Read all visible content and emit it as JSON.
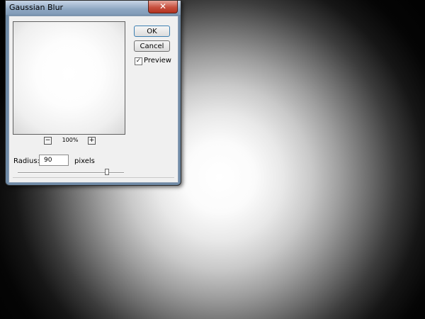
{
  "dialog": {
    "title": "Gaussian Blur",
    "close_glyph": "✕",
    "ok_label": "OK",
    "cancel_label": "Cancel",
    "preview": {
      "checked": true,
      "check_glyph": "✓",
      "label": "Preview"
    },
    "zoom": {
      "out_glyph": "−",
      "in_glyph": "+",
      "level": "100%"
    },
    "radius": {
      "label": "Radius:",
      "value": "90",
      "unit": "pixels"
    }
  },
  "colors": {
    "canvas_background": "#000000",
    "glow_center": "#ffffff",
    "titlebar": "#8ea7c2",
    "close_button": "#c7503f",
    "dialog_body": "#f0f0f0"
  }
}
